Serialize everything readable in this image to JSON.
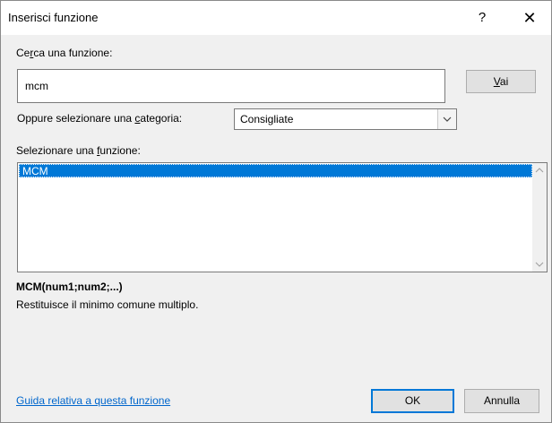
{
  "window": {
    "title": "Inserisci funzione",
    "help_glyph": "?",
    "close_glyph": "✕"
  },
  "search": {
    "label_pre": "Ce",
    "label_key": "r",
    "label_post": "ca una funzione:",
    "value": "mcm",
    "go_pre": "",
    "go_key": "V",
    "go_post": "ai"
  },
  "category": {
    "label_pre": "Oppure selezionare una ",
    "label_key": "c",
    "label_post": "ategoria:",
    "selected": "Consigliate"
  },
  "function_list": {
    "label_pre": "Selezionare una ",
    "label_key": "f",
    "label_post": "unzione:",
    "items": [
      "MCM"
    ],
    "selected_index": 0
  },
  "details": {
    "signature": "MCM(num1;num2;...)",
    "description": "Restituisce il minimo comune multiplo."
  },
  "footer": {
    "help_link": "Guida relativa a questa funzione",
    "ok_label": "OK",
    "cancel_label": "Annulla"
  },
  "colors": {
    "selection": "#0078d7",
    "link": "#0066cc",
    "dialog_bg": "#f0f0f0",
    "focus_border": "#0078d7"
  },
  "icons": {
    "help": "question-mark-icon",
    "close": "close-icon",
    "dropdown": "chevron-down-icon",
    "scroll_up": "chevron-up-icon",
    "scroll_down": "chevron-down-icon"
  }
}
